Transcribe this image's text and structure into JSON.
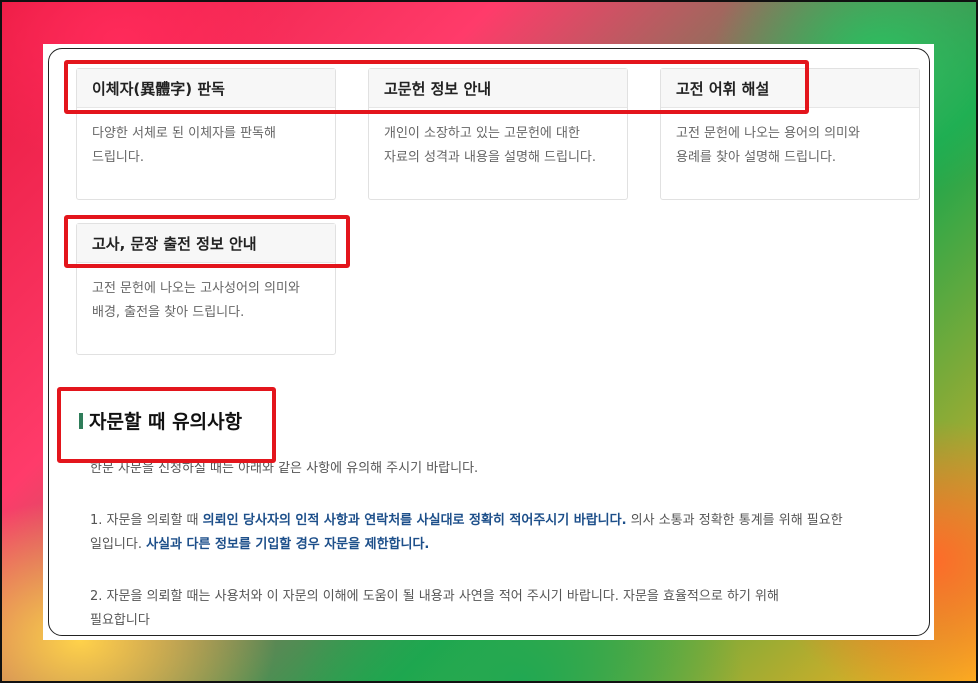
{
  "cards": [
    {
      "title": "이체자(異體字) 판독",
      "desc_line1": "다양한 서체로 된 이체자를 판독해",
      "desc_line2": "드립니다."
    },
    {
      "title": "고문헌 정보 안내",
      "desc_line1": "개인이 소장하고 있는 고문헌에 대한",
      "desc_line2": "자료의 성격과 내용을 설명해 드립니다."
    },
    {
      "title": "고전 어휘 해설",
      "desc_line1": "고전 문헌에 나오는 용어의 의미와",
      "desc_line2": "용례를 찾아 설명해 드립니다."
    },
    {
      "title": "고사, 문장 출전 정보 안내",
      "desc_line1": "고전 문헌에 나오는 고사성어의 의미와",
      "desc_line2": "배경, 출전을 찾아 드립니다."
    }
  ],
  "notice": {
    "title": "자문할 때 유의사항",
    "intro": "한문 자문을 신청하실 때는 아래와 같은 사항에 유의해 주시기 바랍니다.",
    "item1": {
      "prefix": "1. 자문을 의뢰할 때 ",
      "highlight1": "의뢰인 당사자의 인적 사항과 연락처를 사실대로 정확히 적어주시기 바랍니다.",
      "middle": " 의사 소통과 정확한 통계를 위해 필요한",
      "line2_start": "일입니다. ",
      "highlight2": "사실과 다른 정보를 기입할 경우 자문을 제한합니다."
    },
    "item2": {
      "line1": "2. 자문을 의뢰할 때는 사용처와 이 자문의 이해에 도움이 될 내용과 사연을 적어 주시기 바랍니다. 자문을 효율적으로 하기 위해",
      "line2": "필요합니다"
    }
  },
  "colors": {
    "highlight_box": "#e3151c",
    "emphasis_text": "#1d4f8a",
    "title_bar": "#2f7d5a"
  }
}
